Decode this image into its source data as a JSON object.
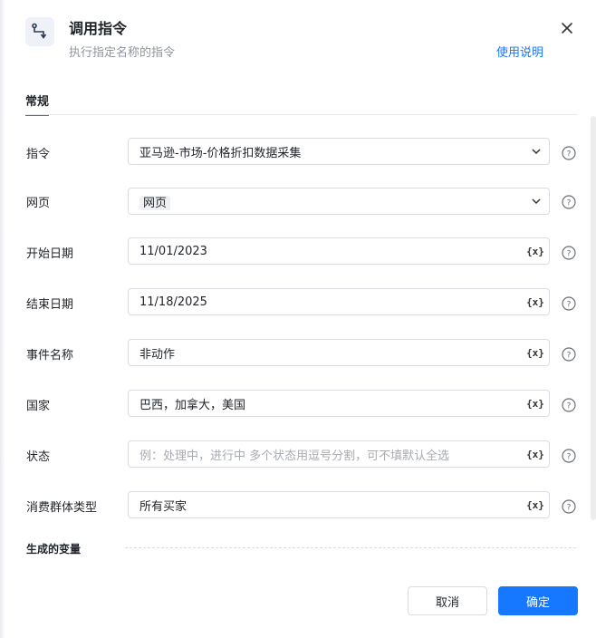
{
  "header": {
    "icon": "command-route-icon",
    "title": "调用指令",
    "subtitle": "执行指定名称的指令",
    "help_link": "使用说明"
  },
  "tabs": [
    {
      "label": "常规",
      "active": true
    }
  ],
  "fields": {
    "command": {
      "label": "指令",
      "value": "亚马逊-市场-价格折扣数据采集"
    },
    "webpage": {
      "label": "网页",
      "value": "网页"
    },
    "start_date": {
      "label": "开始日期",
      "value": "11/01/2023"
    },
    "end_date": {
      "label": "结束日期",
      "value": "11/18/2025"
    },
    "event_name": {
      "label": "事件名称",
      "value": "非动作"
    },
    "country": {
      "label": "国家",
      "value": "巴西，加拿大，美国"
    },
    "status": {
      "label": "状态",
      "value": "",
      "placeholder": "例：处理中，进行中 多个状态用逗号分割，可不填默认全选"
    },
    "consumer_group": {
      "label": "消费群体类型",
      "value": "所有买家"
    }
  },
  "variable_icon_text": "{x}",
  "generated_variables_label": "生成的变量",
  "footer": {
    "cancel": "取消",
    "confirm": "确定"
  },
  "colors": {
    "accent": "#1677ff",
    "border": "#d9dce1",
    "muted": "#8f959e"
  }
}
